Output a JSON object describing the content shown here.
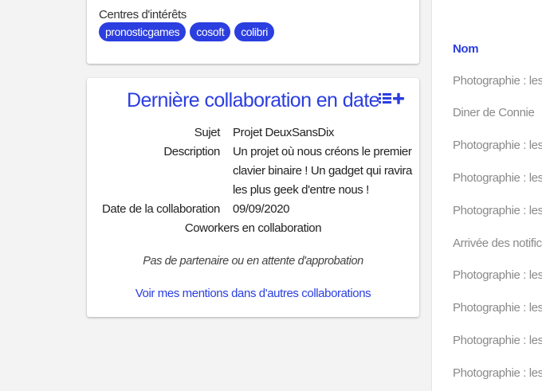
{
  "interests": {
    "label": "Centres d'intérêts",
    "tags": [
      "pronosticgames",
      "cosoft",
      "colibri"
    ],
    "tag_color": "#2b3ee0"
  },
  "collaboration": {
    "title": "Dernière collaboration en date",
    "subject_label": "Sujet",
    "subject": "Projet DeuxSansDix",
    "description_label": "Description",
    "description": "Un projet où nous créons le premier clavier binaire ! Un gadget qui ravira les plus geek d'entre nous !",
    "date_label": "Date de la collaboration",
    "date": "09/09/2020",
    "coworkers_label": "Coworkers en collaboration",
    "no_partner": "Pas de partenaire ou en attente d'approbation",
    "mentions_link": "Voir mes mentions dans d'autres collaborations",
    "action_icons": [
      "list-icon",
      "plus-icon"
    ],
    "accent_color": "#2b3ee0"
  },
  "side_table": {
    "header": "Nom",
    "rows": [
      "Photographie : les ba",
      "Diner de Connie",
      "Photographie : les ba",
      "Photographie : les ba",
      "Photographie : les ba",
      "Arrivée des notificati",
      "Photographie : les ba",
      "Photographie : les ba",
      "Photographie : les ba",
      "Photographie : les ba"
    ]
  }
}
